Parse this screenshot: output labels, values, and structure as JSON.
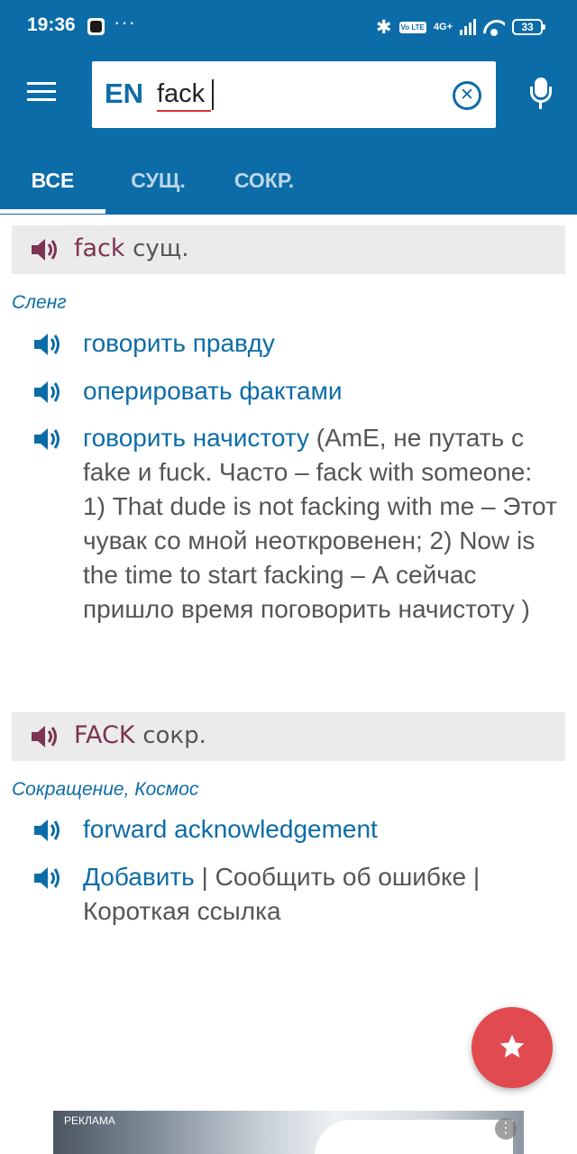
{
  "status_bar": {
    "time": "19:36",
    "more": "···",
    "volte": "Vo LTE",
    "network": "4G+",
    "battery": "33"
  },
  "search": {
    "lang": "EN",
    "query": "fack"
  },
  "tabs": [
    {
      "label": "ВСЕ",
      "active": true
    },
    {
      "label": "СУЩ.",
      "active": false
    },
    {
      "label": "СОКР.",
      "active": false
    }
  ],
  "entries": [
    {
      "word": "fack",
      "pos": "сущ.",
      "subject": "Сленг",
      "translations": [
        {
          "link": "говорить правду",
          "note": ""
        },
        {
          "link": "оперировать фактами",
          "note": ""
        },
        {
          "link": "говорить начистоту",
          "note": " (AmE, не путать с fake и fuck. Часто – fack with someone: 1) That dude is not facking with me – Этот чувак со мной неоткровенен; 2) Now is the time to start facking – А сейчас пришло время поговорить начистоту )"
        }
      ]
    },
    {
      "word": "FACK",
      "pos": "сокр.",
      "subject": "Сокращение, Космос",
      "translations": [
        {
          "link": "forward acknowledgement",
          "note": ""
        }
      ]
    }
  ],
  "footer_links": {
    "add": "Добавить",
    "separator1": " | ",
    "report": "Сообщить об ошибке",
    "separator2": " | ",
    "short_link": "Короткая ссылка"
  },
  "ad": {
    "label": "РЕКЛАМА",
    "info": "⋮"
  },
  "colors": {
    "primary": "#0c6ca8",
    "headword": "#7d3352",
    "fab": "#e14b4f",
    "header_bg": "#ebebeb"
  },
  "icons": {
    "menu": "hamburger-icon",
    "clear": "clear-icon",
    "mic": "microphone-icon",
    "speaker": "speaker-icon",
    "favorite": "star-icon"
  }
}
